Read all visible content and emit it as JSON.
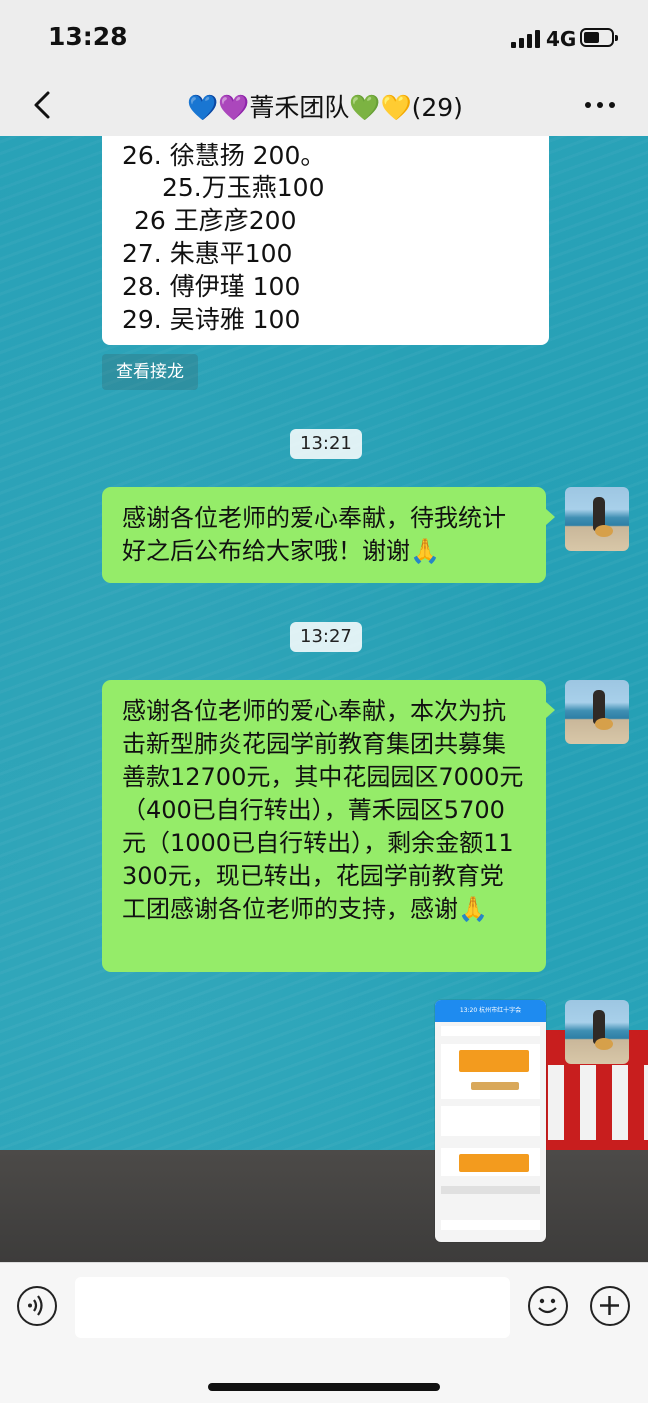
{
  "status_bar": {
    "time": "13:28",
    "network": "4G",
    "icons": [
      "signal-bars-icon",
      "battery-icon"
    ]
  },
  "nav": {
    "back_icon": "chevron-left-icon",
    "title": "💙💜菁禾团队💚💛(29)",
    "more_icon": "more-dots-icon"
  },
  "jielong_card": {
    "lines": [
      "26. 徐慧扬 200。",
      "25.万玉燕100",
      "26 王彦彦200",
      "27. 朱惠平100",
      "28. 傅伊瑾 100",
      "29. 吴诗雅 100"
    ],
    "view_button": "查看接龙"
  },
  "messages": [
    {
      "timestamp": "13:21",
      "text": "感谢各位老师的爱心奉献，待我统计好之后公布给大家哦！谢谢🙏",
      "sender": "me"
    },
    {
      "timestamp": "13:27",
      "text": "感谢各位老师的爱心奉献，本次为抗击新型肺炎花园学前教育集团共募集善款12700元，其中花园园区7000元（400已自行转出），菁禾园区5700元（1000已自行转出），剩余金额11300元，现已转出，花园学前教育党工团感谢各位老师的支持，感谢🙏",
      "sender": "me"
    }
  ],
  "image_message": {
    "header_time": "13:20",
    "header_title": "杭州市红十字会"
  },
  "input_bar": {
    "voice_icon": "voice-icon",
    "emoji_icon": "emoji-icon",
    "plus_icon": "plus-icon",
    "text": ""
  },
  "colors": {
    "bubble_green": "#95ec69",
    "nav_bg": "#ededed",
    "wallpaper_teal": "#25a0b5"
  }
}
